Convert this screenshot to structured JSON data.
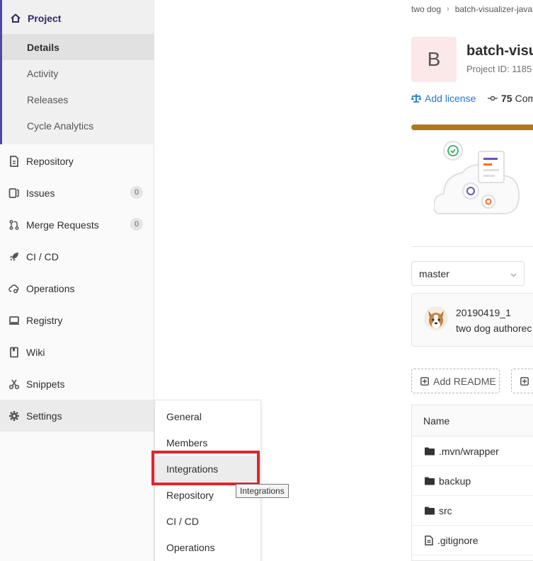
{
  "sidebar": {
    "project": {
      "label": "Project",
      "icon": "home-icon",
      "items": [
        {
          "label": "Details",
          "active": true
        },
        {
          "label": "Activity"
        },
        {
          "label": "Releases"
        },
        {
          "label": "Cycle Analytics"
        }
      ]
    },
    "items": [
      {
        "label": "Repository",
        "icon": "document-icon"
      },
      {
        "label": "Issues",
        "icon": "issues-icon",
        "count": "0"
      },
      {
        "label": "Merge Requests",
        "icon": "merge-request-icon",
        "count": "0"
      },
      {
        "label": "CI / CD",
        "icon": "rocket-icon"
      },
      {
        "label": "Operations",
        "icon": "cloud-gear-icon"
      },
      {
        "label": "Registry",
        "icon": "disk-icon"
      },
      {
        "label": "Wiki",
        "icon": "book-icon"
      },
      {
        "label": "Snippets",
        "icon": "scissors-icon"
      },
      {
        "label": "Settings",
        "icon": "gear-icon"
      }
    ]
  },
  "settings_flyout": {
    "items": [
      "General",
      "Members",
      "Integrations",
      "Repository",
      "CI / CD",
      "Operations"
    ],
    "hovered": "Integrations",
    "tooltip": "Integrations"
  },
  "breadcrumb": [
    "two dog",
    "batch-visualizer-java"
  ],
  "project": {
    "avatar_letter": "B",
    "title": "batch-visu",
    "project_id": "Project ID: 1185",
    "license_link": "Add license",
    "commits_count": "75",
    "commits_label": "Com",
    "language_bar_color": "#b1761e"
  },
  "branch": {
    "selected": "master"
  },
  "last_commit": {
    "title": "20190419_1",
    "meta": "two dog authorec"
  },
  "actions": {
    "add_readme": "Add README"
  },
  "file_table": {
    "header": "Name",
    "rows": [
      {
        "name": ".mvn/wrapper",
        "type": "folder"
      },
      {
        "name": "backup",
        "type": "folder"
      },
      {
        "name": "src",
        "type": "folder"
      },
      {
        "name": ".gitignore",
        "type": "file"
      }
    ]
  },
  "colors": {
    "accent": "#4b4ba3",
    "link": "#1f78d1",
    "highlight": "#e0242c"
  }
}
